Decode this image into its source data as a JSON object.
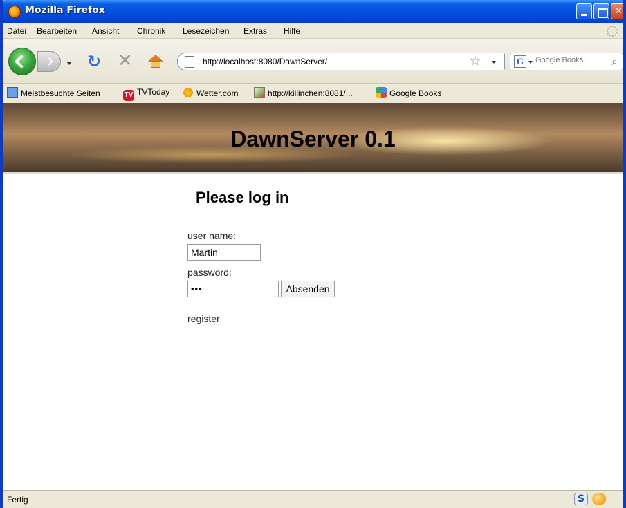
{
  "window": {
    "title": "Mozilla Firefox"
  },
  "menu": [
    "Datei",
    "Bearbeiten",
    "Ansicht",
    "Chronik",
    "Lesezeichen",
    "Extras",
    "Hilfe"
  ],
  "nav": {
    "url": "http://localhost:8080/DawnServer/",
    "search_placeholder": "Google Books"
  },
  "bookmarks": [
    {
      "label": "Meistbesuchte Seiten",
      "icon": "most-visited-icon"
    },
    {
      "label": "TVToday",
      "icon": "tvtoday-icon"
    },
    {
      "label": "Wetter.com",
      "icon": "weather-icon"
    },
    {
      "label": "http://killinchen:8081/...",
      "icon": "page-thumbnail-icon"
    },
    {
      "label": "Google Books",
      "icon": "google-books-icon"
    }
  ],
  "page": {
    "site_title": "DawnServer 0.1",
    "heading": "Please log in",
    "username_label": "user name:",
    "username_value": "Martin",
    "password_label": "password:",
    "password_value": "•••",
    "submit_label": "Absenden",
    "register_link": "register"
  },
  "status": {
    "text": "Fertig"
  },
  "colors": {
    "titlebar": "#0551e0",
    "link": "#333333"
  }
}
